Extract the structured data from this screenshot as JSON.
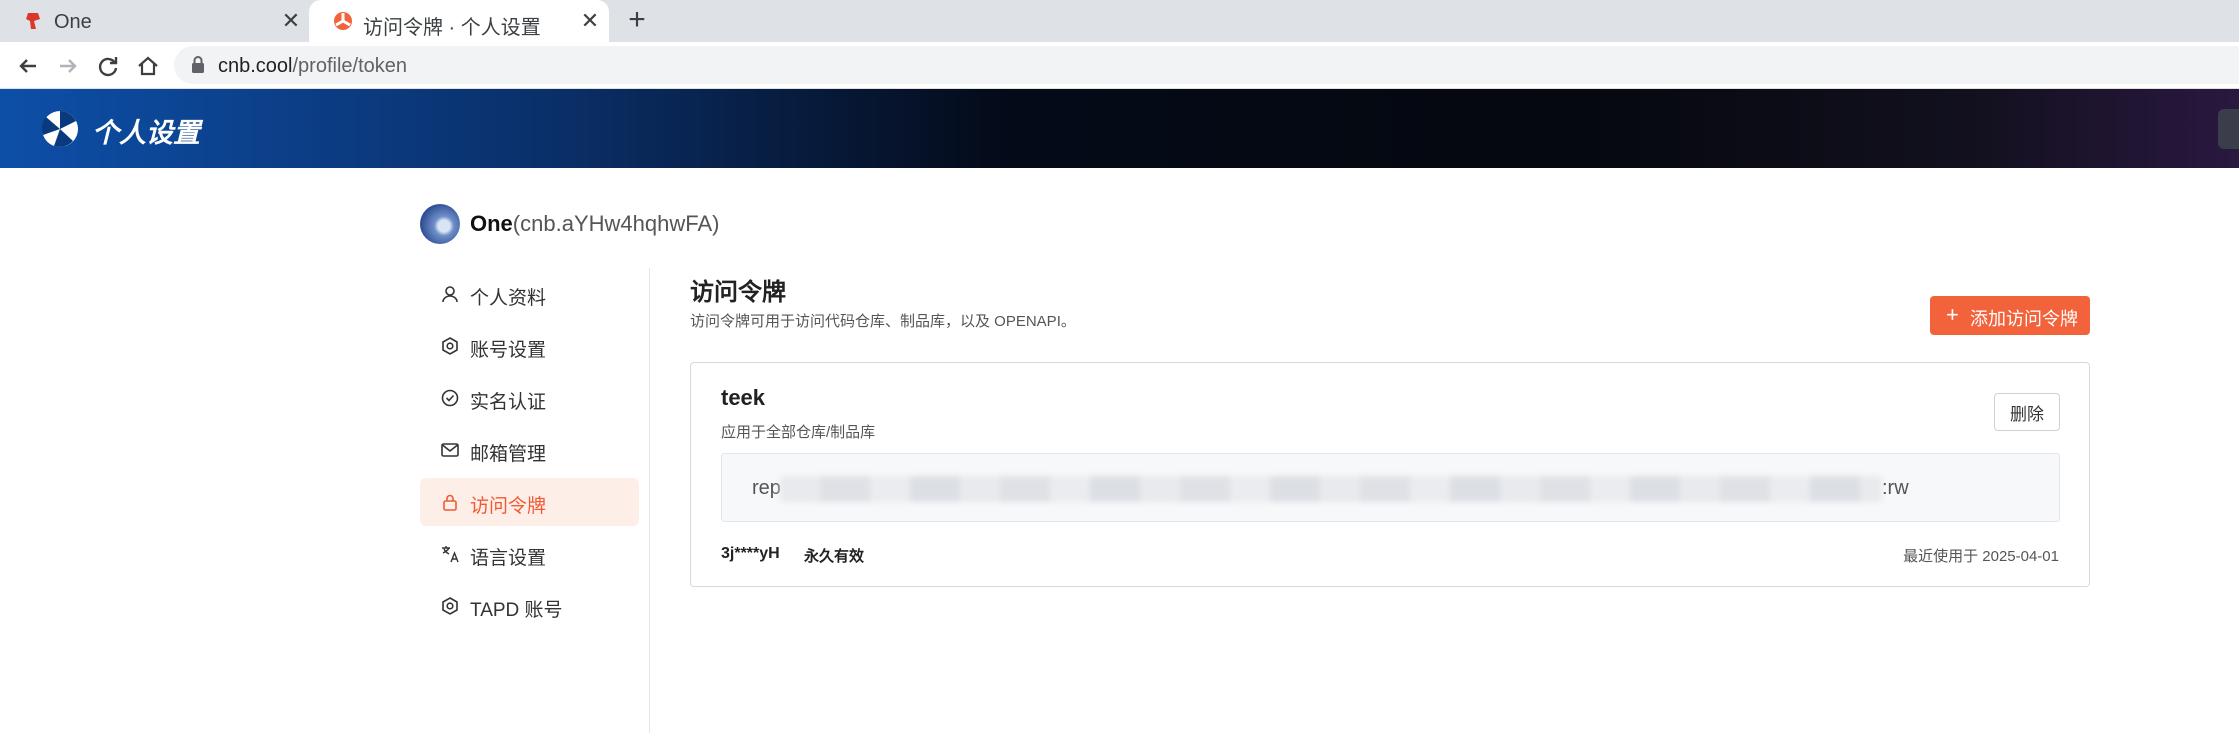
{
  "browser": {
    "tabs": [
      {
        "title": "One"
      },
      {
        "title": "访问令牌 · 个人设置"
      }
    ],
    "new_tab": "+",
    "close_glyph": "✕",
    "url_domain": "cnb.cool",
    "url_path": "/profile/token"
  },
  "header": {
    "site_title": "个人设置"
  },
  "profile": {
    "name": "One",
    "handle": "(cnb.aYHw4hqhwFA)"
  },
  "sidebar": {
    "items": [
      {
        "label": "个人资料",
        "icon": "user-icon"
      },
      {
        "label": "账号设置",
        "icon": "gear-icon"
      },
      {
        "label": "实名认证",
        "icon": "verified-badge-icon"
      },
      {
        "label": "邮箱管理",
        "icon": "mail-icon"
      },
      {
        "label": "访问令牌",
        "icon": "lock-icon",
        "active": true
      },
      {
        "label": "语言设置",
        "icon": "language-icon"
      },
      {
        "label": "TAPD 账号",
        "icon": "hexagon-icon"
      }
    ]
  },
  "main": {
    "title": "访问令牌",
    "subtitle": "访问令牌可用于访问代码仓库、制品库，以及 OPENAPI。",
    "add_button": "添加访问令牌",
    "token": {
      "name": "teek",
      "scope": "应用于全部仓库/制品库",
      "delete_label": "删除",
      "value_prefix": "rep",
      "value_suffix": ":rw",
      "id": "3j****yH",
      "expiry": "永久有效",
      "last_used": "最近使用于 2025-04-01"
    }
  },
  "colors": {
    "accent": "#f2633c",
    "active_bg": "#fdeee8",
    "header_start": "#0d4fa8",
    "header_end": "#2a1840"
  }
}
